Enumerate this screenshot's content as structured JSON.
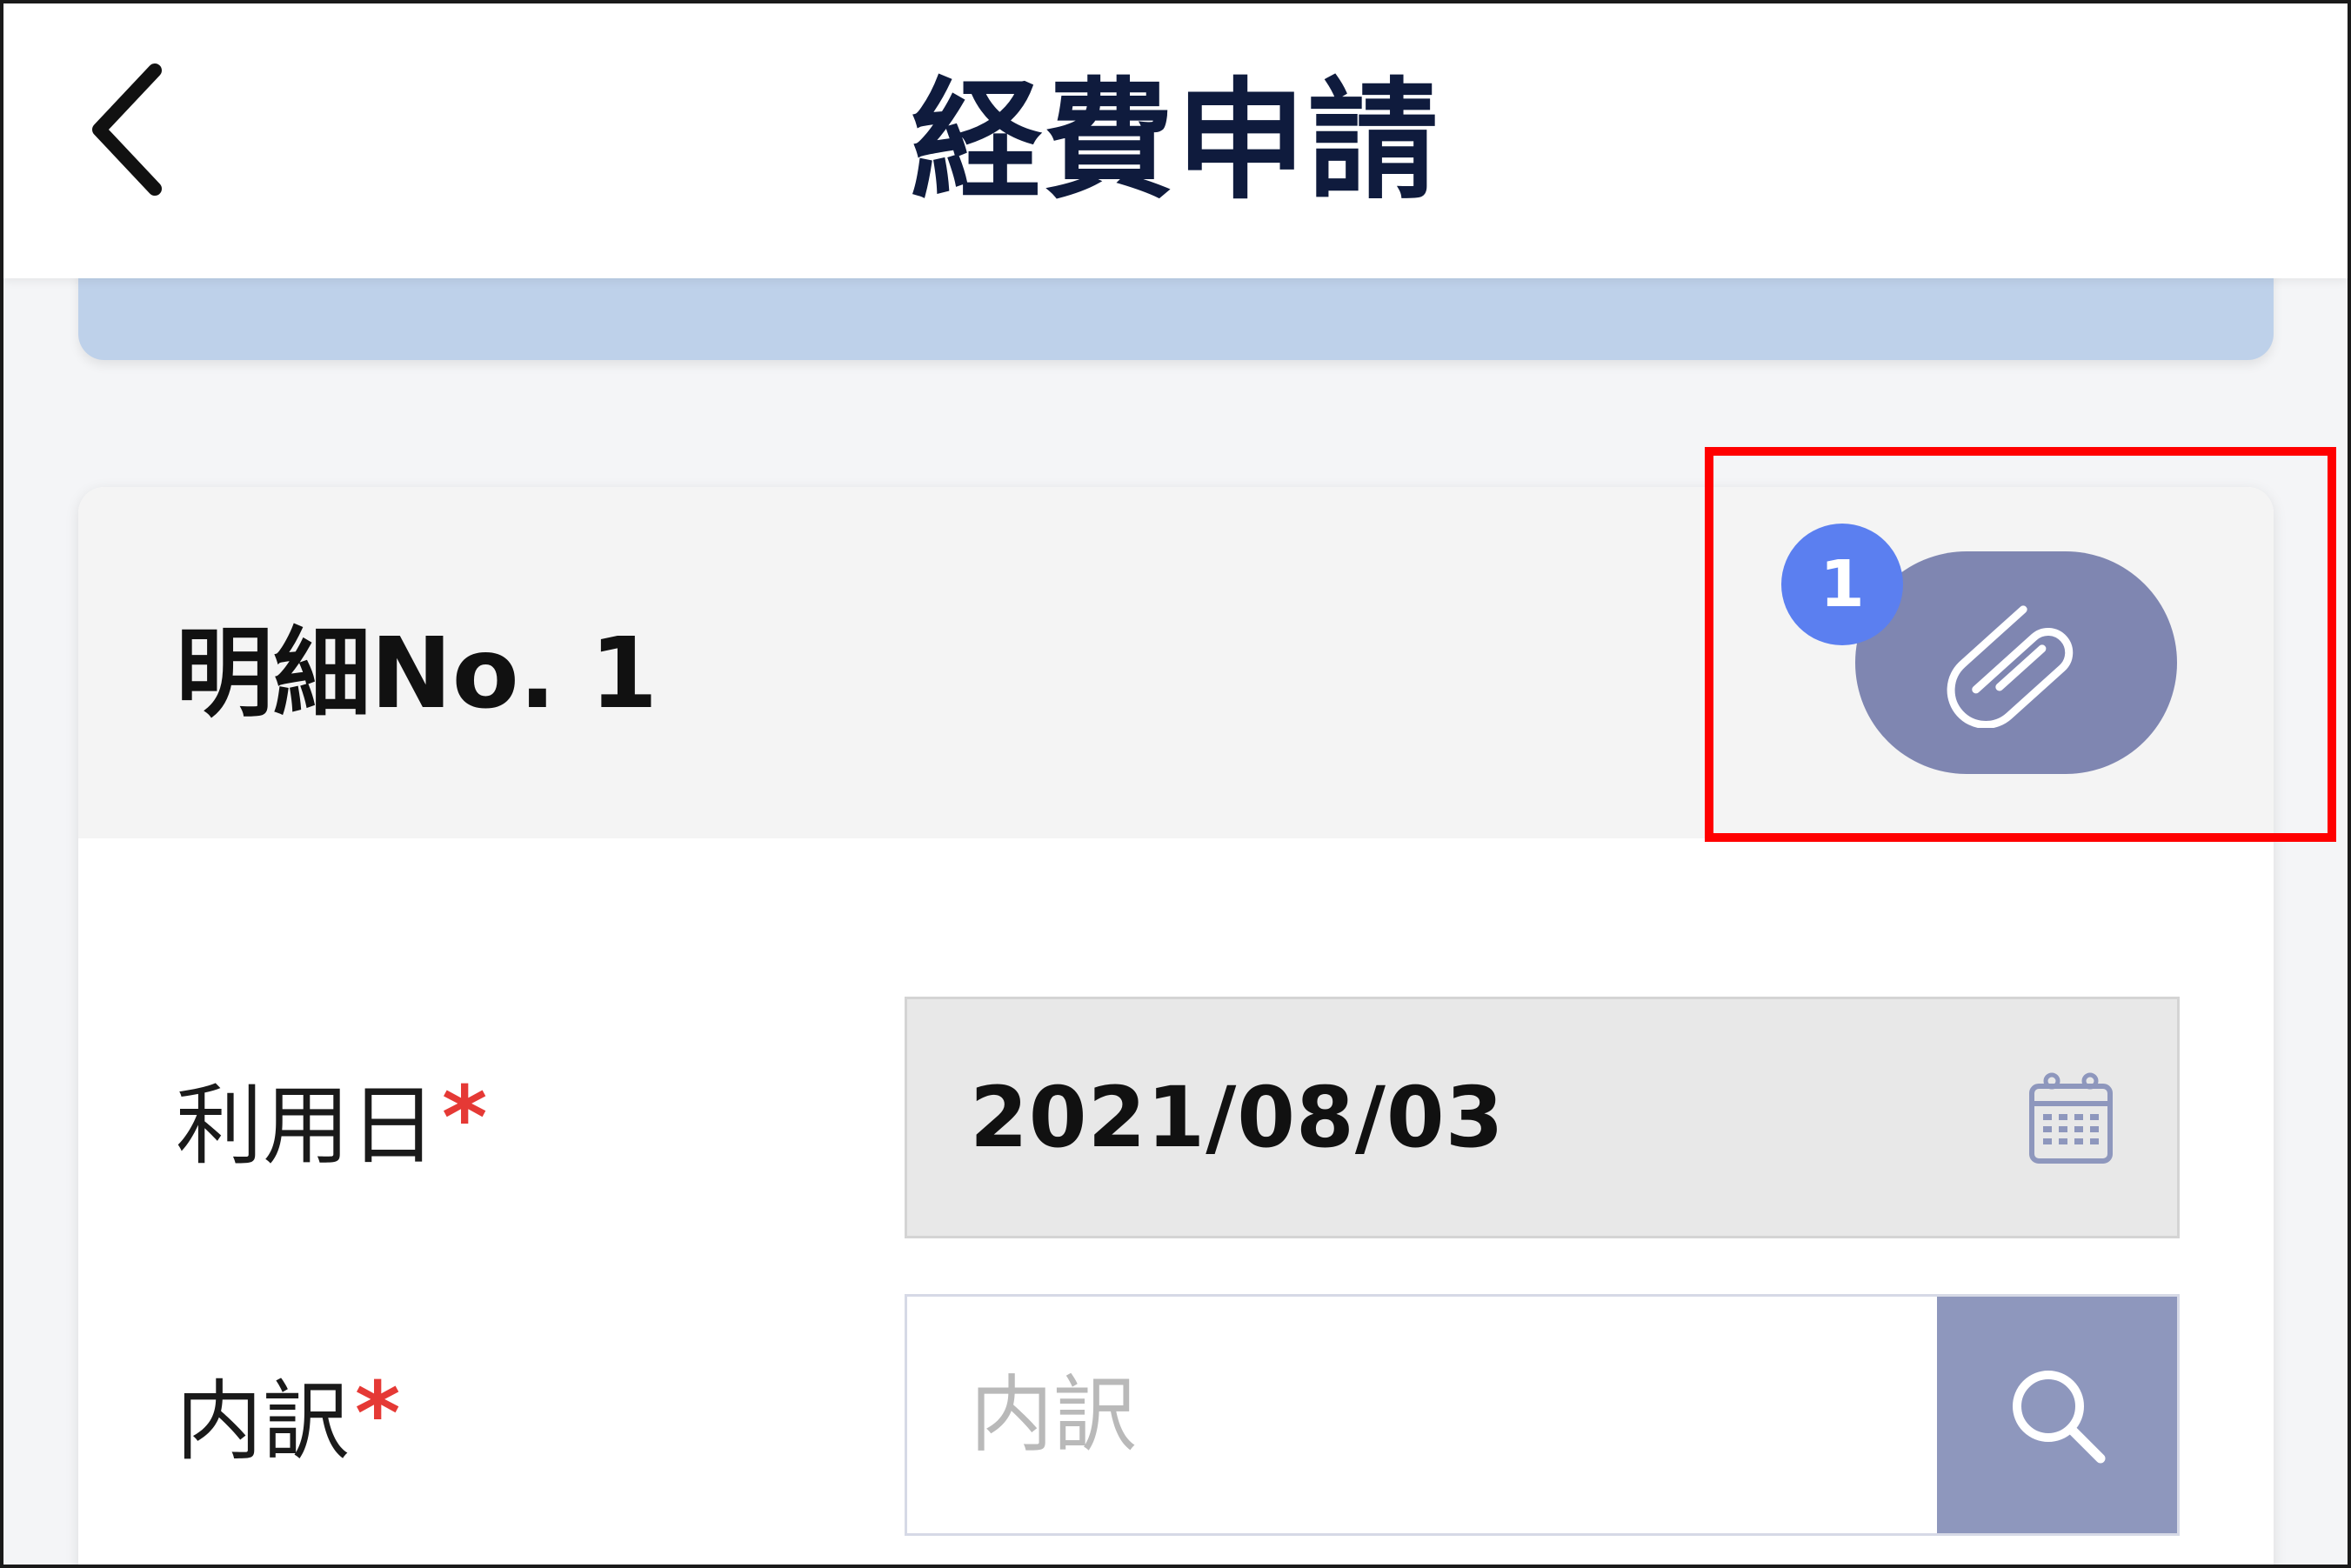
{
  "header": {
    "title": "経費申請",
    "back_icon": "chevron-left-icon"
  },
  "detail": {
    "title": "明細No. 1",
    "attachment": {
      "icon": "paperclip-icon",
      "badge_count": "1"
    }
  },
  "form": {
    "usage_date": {
      "label": "利用日",
      "required_mark": "*",
      "value": "2021/08/03",
      "icon": "calendar-icon"
    },
    "breakdown": {
      "label": "内訳",
      "required_mark": "*",
      "placeholder": "内訳",
      "value": "",
      "icon": "search-icon"
    }
  },
  "colors": {
    "title_navy": "#0f1b3d",
    "accent_blue": "#5b7ff0",
    "attach_button": "#7f86b1",
    "search_button": "#8e97bd",
    "required_red": "#e53935",
    "highlight_red": "#ff0000",
    "collapsed_card": "#bed1ea"
  }
}
